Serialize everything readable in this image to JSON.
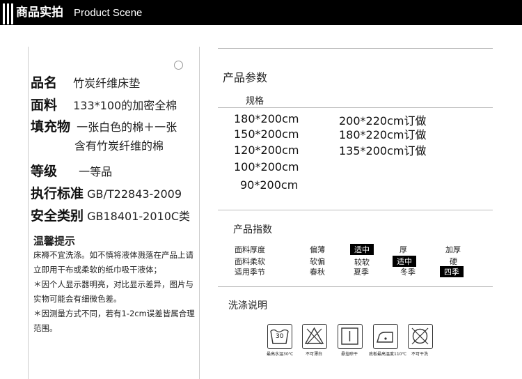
{
  "header": {
    "title": "商品实拍",
    "subtitle": "Product Scene"
  },
  "left": {
    "rows": [
      {
        "label": "品名",
        "value": "竹炭纤维床垫"
      },
      {
        "label": "面料",
        "value": "133*100的加密全棉"
      },
      {
        "label": "填充物",
        "value": "一张白色的棉＋一张"
      },
      {
        "label": "",
        "value": "含有竹炭纤维的棉"
      },
      {
        "label": "等级",
        "value": "一等品"
      },
      {
        "label": "执行标准",
        "value": "GB/T22843-2009"
      },
      {
        "label": "安全类别",
        "value": "GB18401-2010C类"
      }
    ],
    "tips_title": "温馨提示",
    "tips": [
      "床褥不宜洗涤。如不慎将液体溅落在产品上请立即用干布或柔软的纸巾吸干液体；",
      "＊因个人显示器明亮，对比显示差异，图片与实物可能会有细微色差。",
      "＊因测量方式不同，若有1-2cm误差皆属合理范围。"
    ]
  },
  "params": {
    "title": "产品参数",
    "spec_label": "规格",
    "sizes_left": [
      "180*200cm",
      "150*200cm",
      "120*200cm",
      "100*200cm",
      "90*200cm"
    ],
    "sizes_right": [
      "200*220cm订做",
      "180*220cm订做",
      "135*200cm订做"
    ]
  },
  "index": {
    "title": "产品指数",
    "rows": [
      {
        "label": "面料厚度",
        "options": [
          "偏薄",
          "适中",
          "厚",
          "加厚"
        ],
        "selected": 1
      },
      {
        "label": "面料柔软",
        "options": [
          "软偏",
          "较软",
          "适中",
          "硬"
        ],
        "selected": 2
      },
      {
        "label": "适用季节",
        "options": [
          "春秋",
          "夏季",
          "冬季",
          "四季"
        ],
        "selected": 3
      }
    ]
  },
  "wash": {
    "title": "洗涤说明",
    "icons": [
      {
        "name": "wash-30-icon",
        "number": "30",
        "label": "最高水温30℃"
      },
      {
        "name": "no-bleach-icon",
        "label": "不可漂白"
      },
      {
        "name": "hang-dry-icon",
        "label": "悬挂晾干"
      },
      {
        "name": "iron-110-icon",
        "label": "底板最高温度110℃"
      },
      {
        "name": "no-dry-clean-icon",
        "label": "不可干洗"
      }
    ]
  }
}
